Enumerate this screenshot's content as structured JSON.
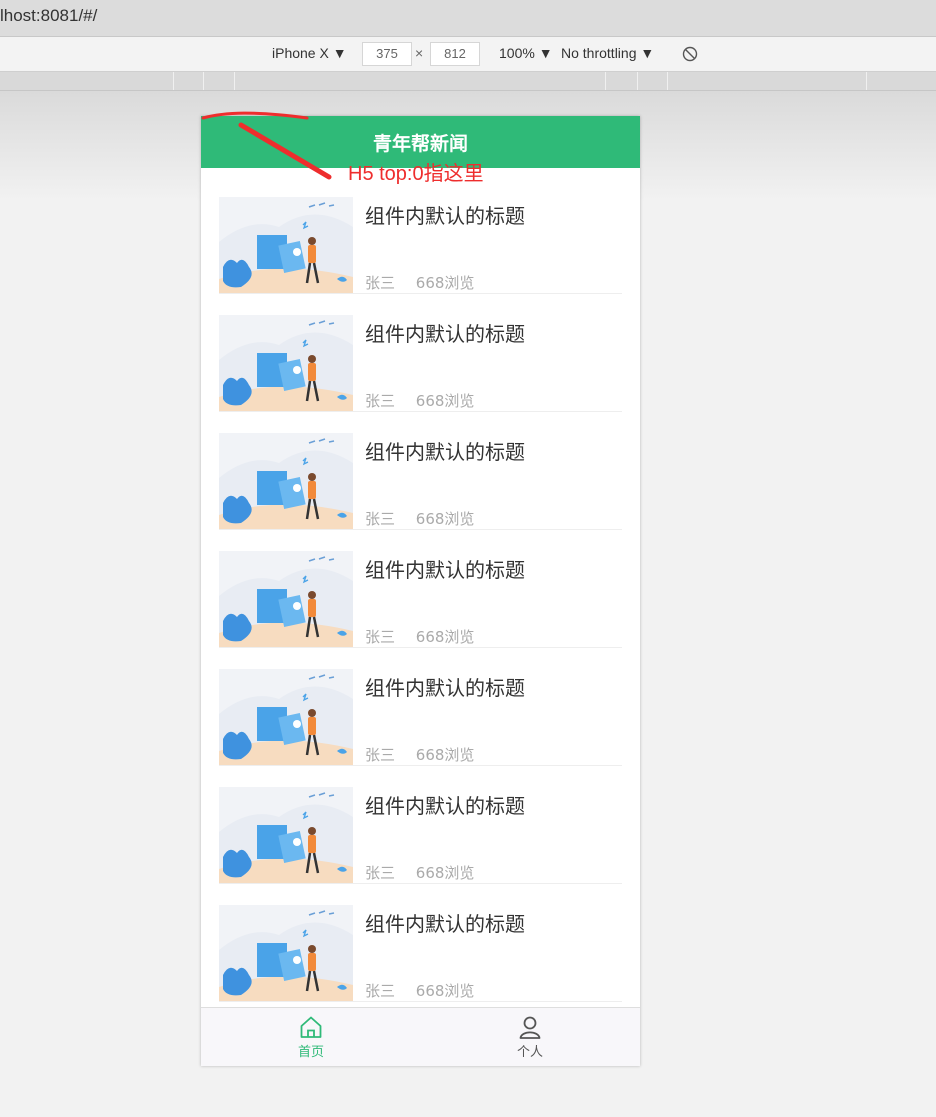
{
  "browser": {
    "url": "lhost:8081/#/",
    "device": "iPhone X ▼",
    "width": "375",
    "times": "×",
    "height": "812",
    "zoom": "100% ▼",
    "throttling": "No throttling ▼",
    "rotate_icon": "rotate-icon"
  },
  "app": {
    "title": "青年帮新闻",
    "news": [
      {
        "title": "组件内默认的标题",
        "author": "张三",
        "views": "668浏览"
      },
      {
        "title": "组件内默认的标题",
        "author": "张三",
        "views": "668浏览"
      },
      {
        "title": "组件内默认的标题",
        "author": "张三",
        "views": "668浏览"
      },
      {
        "title": "组件内默认的标题",
        "author": "张三",
        "views": "668浏览"
      },
      {
        "title": "组件内默认的标题",
        "author": "张三",
        "views": "668浏览"
      },
      {
        "title": "组件内默认的标题",
        "author": "张三",
        "views": "668浏览"
      },
      {
        "title": "组件内默认的标题",
        "author": "张三",
        "views": "668浏览"
      }
    ],
    "tabs": [
      {
        "label": "首页",
        "icon": "home-icon",
        "active": true
      },
      {
        "label": "个人",
        "icon": "user-icon",
        "active": false
      }
    ]
  },
  "annotation": {
    "text": "H5 top:0指这里",
    "color": "#ee2d2d"
  },
  "colors": {
    "brand": "#2fba78"
  }
}
